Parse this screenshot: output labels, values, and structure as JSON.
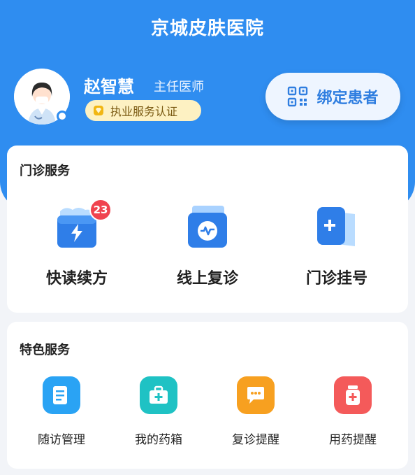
{
  "header": {
    "title": "京城皮肤医院"
  },
  "doctor": {
    "name": "赵智慧",
    "title": "主任医师",
    "certification": "执业服务认证",
    "bind_button": "绑定患者"
  },
  "outpatient": {
    "title": "门诊服务",
    "items": [
      {
        "label": "快读续方",
        "badge": "23",
        "icon": "quick-renewal-icon"
      },
      {
        "label": "线上复诊",
        "icon": "online-revisit-icon"
      },
      {
        "label": "门诊挂号",
        "icon": "registration-icon"
      }
    ]
  },
  "featured": {
    "title": "特色服务",
    "items": [
      {
        "label": "随访管理",
        "icon": "followup-icon",
        "color": "#2aa3f4"
      },
      {
        "label": "我的药箱",
        "icon": "medicine-box-icon",
        "color": "#1fc2c4"
      },
      {
        "label": "复诊提醒",
        "icon": "chat-reminder-icon",
        "color": "#f7a020"
      },
      {
        "label": "用药提醒",
        "icon": "medicine-bottle-icon",
        "color": "#f45a5a"
      }
    ]
  },
  "colors": {
    "primary": "#2f8df0",
    "badge": "#f0434f"
  }
}
